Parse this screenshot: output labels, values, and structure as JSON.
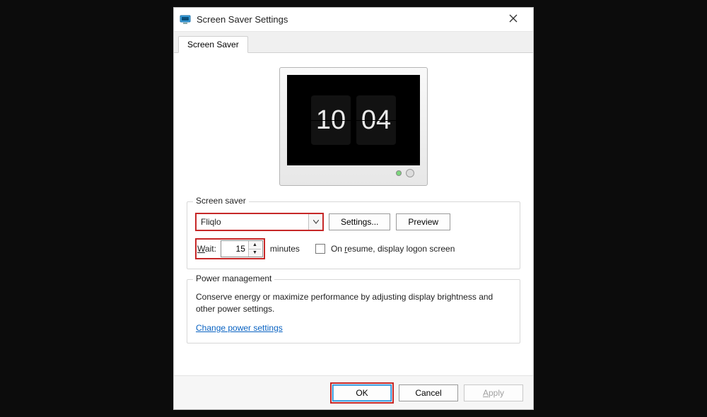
{
  "window": {
    "title": "Screen Saver Settings"
  },
  "tab": {
    "label": "Screen Saver"
  },
  "preview": {
    "clock_hh": "10",
    "clock_mm": "04"
  },
  "screensaver": {
    "group_label": "Screen saver",
    "selected": "Fliqlo",
    "settings_btn": "Settings...",
    "preview_btn": "Preview",
    "wait_label": "Wait:",
    "wait_value": "15",
    "wait_unit": "minutes",
    "resume_label": "On resume, display logon screen"
  },
  "power": {
    "group_label": "Power management",
    "description": "Conserve energy or maximize performance by adjusting display brightness and other power settings.",
    "link": "Change power settings"
  },
  "buttons": {
    "ok": "OK",
    "cancel": "Cancel",
    "apply": "Apply"
  }
}
